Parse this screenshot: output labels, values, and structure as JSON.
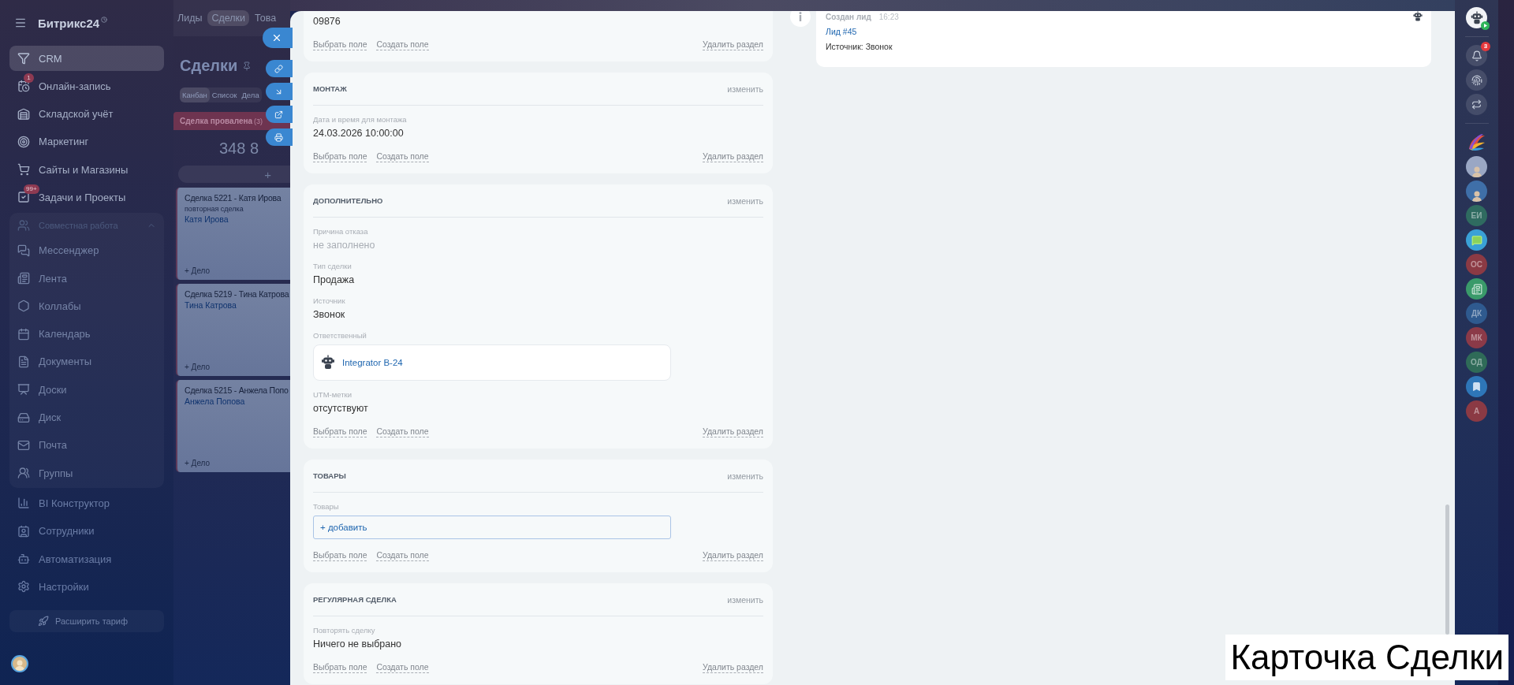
{
  "sidebar": {
    "logo": "Битрикс24",
    "items": [
      {
        "label": "CRM",
        "selected": true
      },
      {
        "label": "Онлайн-запись",
        "selected": false,
        "badge": "1"
      },
      {
        "label": "Складской учёт",
        "selected": false
      },
      {
        "label": "Маркетинг",
        "selected": false
      },
      {
        "label": "Сайты и Магазины",
        "selected": false
      },
      {
        "label": "Задачи и Проекты",
        "selected": false,
        "badge": "99+"
      },
      {
        "label": "Совместная работа",
        "selected": false,
        "expanded": true,
        "children": [
          {
            "label": "Мессенджер",
            "selected": false
          },
          {
            "label": "Лента",
            "selected": false
          },
          {
            "label": "Коллабы",
            "selected": false
          },
          {
            "label": "Календарь",
            "selected": false
          },
          {
            "label": "Документы",
            "selected": false
          },
          {
            "label": "Доски",
            "selected": false
          },
          {
            "label": "Диск",
            "selected": false
          },
          {
            "label": "Почта",
            "selected": false
          },
          {
            "label": "Группы",
            "selected": false
          }
        ]
      },
      {
        "label": "BI Конструктор",
        "selected": false
      },
      {
        "label": "Сотрудники",
        "selected": false
      },
      {
        "label": "Автоматизация",
        "selected": false
      },
      {
        "label": "Настройки",
        "selected": false
      }
    ],
    "upgrade": "Расширить тариф"
  },
  "kanban": {
    "tabs": [
      {
        "label": "Лиды",
        "selected": false
      },
      {
        "label": "Сделки",
        "selected": true
      },
      {
        "label": "Това",
        "selected": false
      }
    ],
    "title": "Сделки",
    "views": [
      {
        "label": "Канбан",
        "selected": true
      },
      {
        "label": "Список",
        "selected": false
      },
      {
        "label": "Дела",
        "selected": false
      }
    ],
    "column": {
      "title": "Сделка провалена",
      "count": "(3)",
      "sum": "348 8",
      "add": "+"
    },
    "cards": [
      {
        "title": "Сделка 5221 - Катя Ирова",
        "note": "повторная сделка",
        "contact": "Катя Ирова",
        "action": "+ Дело"
      },
      {
        "title": "Сделка 5219 - Тина Катрова",
        "contact": "Тина Катрова",
        "action": "+ Дело"
      },
      {
        "title": "Сделка 5215 - Анжела Попо",
        "contact": "Анжела Попова",
        "action": "+ Дело"
      }
    ]
  },
  "form": {
    "sections": [
      {
        "fields": [
          {
            "kind": "text",
            "value": "09876"
          }
        ],
        "footer": {
          "choose": "Выбрать поле",
          "create": "Создать поле",
          "delete": "Удалить раздел"
        }
      },
      {
        "title": "МОНТАЖ",
        "edit": "изменить",
        "fields": [
          {
            "kind": "text",
            "label": "Дата и время для монтажа",
            "value": "24.03.2026 10:00:00"
          }
        ],
        "footer": {
          "choose": "Выбрать поле",
          "create": "Создать поле",
          "delete": "Удалить раздел"
        }
      },
      {
        "title": "ДОПОЛНИТЕЛЬНО",
        "edit": "изменить",
        "fields": [
          {
            "kind": "empty",
            "label": "Причина отказа",
            "value": "не заполнено"
          },
          {
            "kind": "text",
            "label": "Тип сделки",
            "value": "Продажа"
          },
          {
            "kind": "text",
            "label": "Источник",
            "value": "Звонок"
          },
          {
            "kind": "user",
            "label": "Ответственный",
            "value": "Integrator B-24"
          },
          {
            "kind": "text",
            "label": "UTM-метки",
            "value": "отсутствуют"
          }
        ],
        "footer": {
          "choose": "Выбрать поле",
          "create": "Создать поле",
          "delete": "Удалить раздел"
        }
      },
      {
        "title": "ТОВАРЫ",
        "edit": "изменить",
        "fields": [
          {
            "kind": "products",
            "label": "Товары",
            "value": "+ добавить"
          }
        ],
        "footer": {
          "choose": "Выбрать поле",
          "create": "Создать поле",
          "delete": "Удалить раздел"
        }
      },
      {
        "title": "РЕГУЛЯРНАЯ СДЕЛКА",
        "edit": "изменить",
        "fields": [
          {
            "kind": "text",
            "label": "Повторять сделку",
            "value": "Ничего не выбрано"
          }
        ],
        "footer": {
          "choose": "Выбрать поле",
          "create": "Создать поле",
          "delete": "Удалить раздел"
        }
      }
    ]
  },
  "timeline": {
    "entries": [
      {
        "title": "Создан лид",
        "time": "16:23",
        "link": "Лид #45",
        "text": "Источник: Звонок"
      }
    ]
  },
  "rail": {
    "notifications": "3",
    "items": [
      {
        "kind": "swirl"
      },
      {
        "kind": "photo",
        "color": "#9aa7c4"
      },
      {
        "kind": "photo",
        "color": "#3f6fa8"
      },
      {
        "kind": "initials",
        "text": "ЕИ",
        "color": "#2f6b60"
      },
      {
        "kind": "chat",
        "color": "#3aa1d6"
      },
      {
        "kind": "initials",
        "text": "ОС",
        "color": "#8b3a44"
      },
      {
        "kind": "news",
        "color": "#3a9a6a"
      },
      {
        "kind": "initials",
        "text": "ДК",
        "color": "#2f5a8f"
      },
      {
        "kind": "initials",
        "text": "МК",
        "color": "#8b3a48"
      },
      {
        "kind": "initials",
        "text": "ОД",
        "color": "#2f6b58"
      },
      {
        "kind": "bookmark",
        "color": "#2e76b8"
      },
      {
        "kind": "initials",
        "text": "А",
        "color": "#8b3a44"
      }
    ]
  },
  "caption": "Карточка Сделки"
}
